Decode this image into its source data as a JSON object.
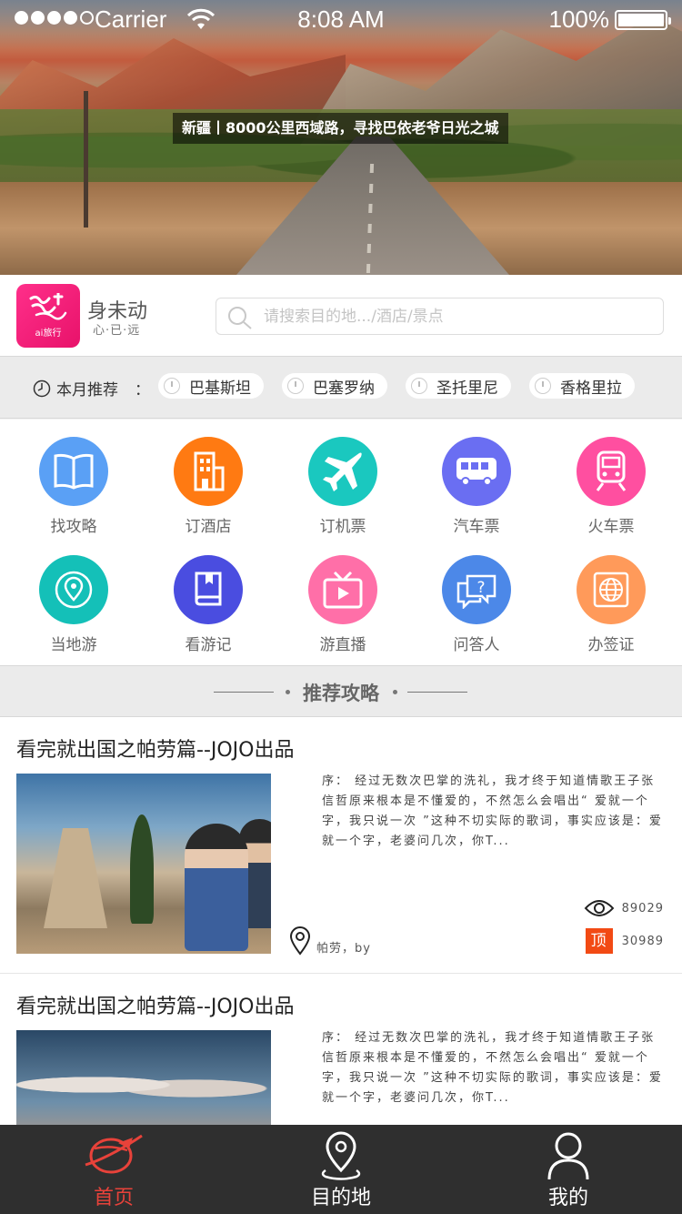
{
  "status_bar": {
    "carrier": "Carrier",
    "time": "8:08 AM",
    "battery": "100%"
  },
  "hero": {
    "caption": "新疆丨8000公里西域路，寻找巴依老爷日光之城"
  },
  "brand": {
    "logo_text": "ai旅行",
    "name": "身未动",
    "slogan": "心·已·远"
  },
  "search": {
    "placeholder": "请搜索目的地.../酒店/景点"
  },
  "recommend": {
    "label": "本月推荐",
    "colon": "：",
    "tags": [
      "巴基斯坦",
      "巴塞罗纳",
      "圣托里尼",
      "香格里拉"
    ]
  },
  "categories": [
    {
      "label": "找攻略",
      "icon": "book-icon",
      "color": "#5aa0f5"
    },
    {
      "label": "订酒店",
      "icon": "hotel-icon",
      "color": "#ff7a12"
    },
    {
      "label": "订机票",
      "icon": "airplane-icon",
      "color": "#1ac8bf"
    },
    {
      "label": "汽车票",
      "icon": "bus-icon",
      "color": "#6a6ef2"
    },
    {
      "label": "火车票",
      "icon": "train-icon",
      "color": "#ff4fa0"
    },
    {
      "label": "当地游",
      "icon": "location-icon",
      "color": "#14c0b8"
    },
    {
      "label": "看游记",
      "icon": "travel-book-icon",
      "color": "#4a4de0"
    },
    {
      "label": "游直播",
      "icon": "live-tv-icon",
      "color": "#ff6fa8"
    },
    {
      "label": "问答人",
      "icon": "question-chat-icon",
      "color": "#4c88e8"
    },
    {
      "label": "办签证",
      "icon": "visa-globe-icon",
      "color": "#ff9a5a"
    }
  ],
  "section": {
    "title": "推荐攻略"
  },
  "articles": [
    {
      "title": "看完就出国之帕劳篇--JOJO出品",
      "excerpt": "序： 经过无数次巴掌的洗礼，我才终于知道情歌王子张信哲原来根本是不懂爱的，不然怎么会唱出“ 爱就一个字，我只说一次 ”这种不切实际的歌词，事实应该是：爱就一个字，老婆问几次，你T...",
      "location": "帕劳，by",
      "views": "89029",
      "top_label": "顶",
      "tops": "30989"
    },
    {
      "title": "看完就出国之帕劳篇--JOJO出品",
      "excerpt": "序： 经过无数次巴掌的洗礼，我才终于知道情歌王子张信哲原来根本是不懂爱的，不然怎么会唱出“ 爱就一个字，我只说一次 ”这种不切实际的歌词，事实应该是：爱就一个字，老婆问几次，你T..."
    }
  ],
  "tabbar": {
    "tabs": [
      {
        "label": "首页",
        "icon": "airplane-globe-icon",
        "active": true
      },
      {
        "label": "目的地",
        "icon": "map-pin-icon",
        "active": false
      },
      {
        "label": "我的",
        "icon": "user-icon",
        "active": false
      }
    ],
    "active_color": "#e8423a"
  }
}
